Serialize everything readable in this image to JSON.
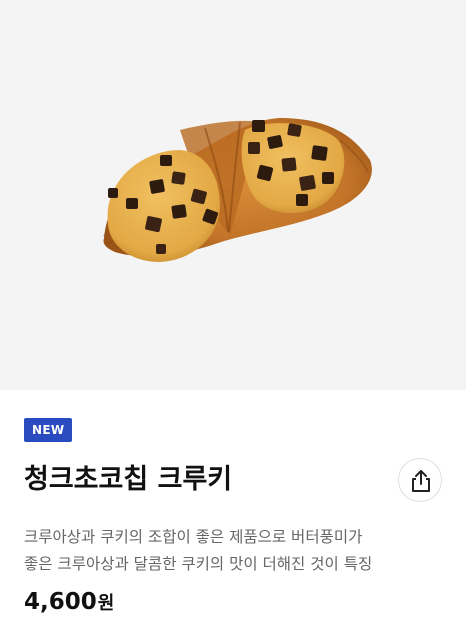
{
  "product": {
    "image_alt": "chunk chocolate chip cookie croissant",
    "badge": "NEW",
    "name": "청크초코칩 크루키",
    "description_lines": [
      "크루아상과 쿠키의 조합이 좋은 제품으로 버터풍미가",
      "좋은 크루아상과 달콤한 쿠키의 맛이 더해진 것이 특징"
    ],
    "price": "4,600",
    "price_unit": "원"
  },
  "icons": {
    "share": "share-icon"
  },
  "colors": {
    "hero_background": "#f4f4f4",
    "badge_background": "#2a4bc0",
    "description_text": "#666666"
  }
}
